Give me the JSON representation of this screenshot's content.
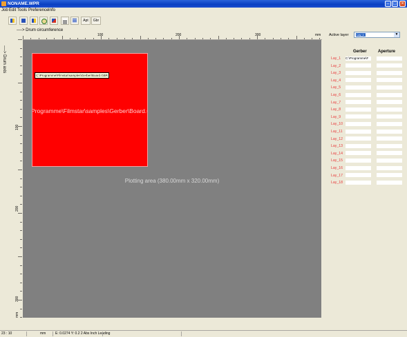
{
  "window": {
    "title": "NONAME.WPR"
  },
  "menu": [
    "Job",
    "Edit",
    "Tools",
    "Preference",
    "Info"
  ],
  "toolbar": {
    "icons": [
      "layout-icon",
      "table-icon",
      "layout-alt-icon",
      "zoom-icon",
      "move-icon",
      "print-icon",
      "list-icon"
    ],
    "text_buttons": [
      "Apt",
      "Gbr"
    ]
  },
  "canvas": {
    "drum_circumference_label": "----> Drum circumference",
    "drum_axis_label": "----> Drum axis",
    "ruler_unit": "mm",
    "h_ticks": [
      "100",
      "200",
      "300"
    ],
    "v_ticks": [
      "100",
      "200",
      "300"
    ],
    "plot_label": "Plotting area (380.00mm x 320.00mm)",
    "board_tooltip": "C:\\Programme\\Filmstar\\samples\\Gerber\\Board.GBR",
    "board_path": "Programme\\Filmstar\\samples\\Gerber\\Board.G"
  },
  "panel": {
    "active_layer_label": "Active layer",
    "active_layer_value": "Lay_1",
    "gerber_header": "Gerber",
    "aperture_header": "Aperture",
    "layers": [
      {
        "name": "Lay_1",
        "gerber": "C:\\Programme\\F",
        "aperture": ""
      },
      {
        "name": "Lay_2",
        "gerber": "",
        "aperture": ""
      },
      {
        "name": "Lay_3",
        "gerber": "",
        "aperture": ""
      },
      {
        "name": "Lay_4",
        "gerber": "",
        "aperture": ""
      },
      {
        "name": "Lay_5",
        "gerber": "",
        "aperture": ""
      },
      {
        "name": "Lay_6",
        "gerber": "",
        "aperture": ""
      },
      {
        "name": "Lay_7",
        "gerber": "",
        "aperture": ""
      },
      {
        "name": "Lay_8",
        "gerber": "",
        "aperture": ""
      },
      {
        "name": "Lay_9",
        "gerber": "",
        "aperture": ""
      },
      {
        "name": "Lay_10",
        "gerber": "",
        "aperture": ""
      },
      {
        "name": "Lay_11",
        "gerber": "",
        "aperture": ""
      },
      {
        "name": "Lay_12",
        "gerber": "",
        "aperture": ""
      },
      {
        "name": "Lay_13",
        "gerber": "",
        "aperture": ""
      },
      {
        "name": "Lay_14",
        "gerber": "",
        "aperture": ""
      },
      {
        "name": "Lay_15",
        "gerber": "",
        "aperture": ""
      },
      {
        "name": "Lay_16",
        "gerber": "",
        "aperture": ""
      },
      {
        "name": "Lay_17",
        "gerber": "",
        "aperture": ""
      },
      {
        "name": "Lay_18",
        "gerber": "",
        "aperture": ""
      }
    ]
  },
  "status": {
    "coords": "23 : 10",
    "unit": "mm",
    "info": "E: 0.0274 Y: 0.2 2 Abs Inch Leading"
  },
  "colors": {
    "titlebar": "#0A3FC2",
    "plot_bg": "#808080",
    "board_fill": "#FF0000",
    "layer_label": "#E8383A",
    "combo_selection": "#316AC5"
  }
}
